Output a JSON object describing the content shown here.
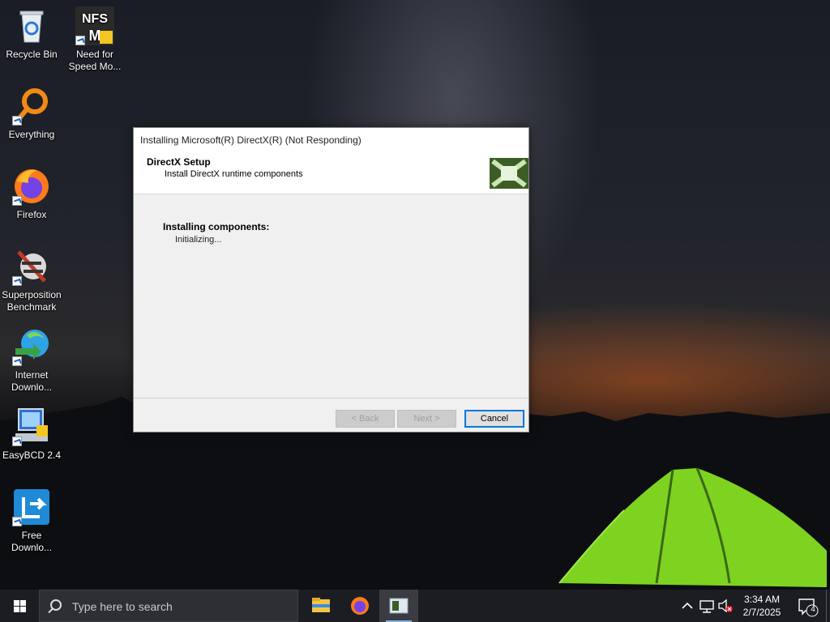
{
  "desktop": {
    "icons": [
      {
        "label": "Recycle Bin",
        "icon": "recycle-bin-icon"
      },
      {
        "label": "Need for Speed Mo...",
        "icon": "nfs-game-icon"
      },
      {
        "label": "Everything",
        "icon": "everything-search-icon"
      },
      {
        "label": "Firefox",
        "icon": "firefox-icon"
      },
      {
        "label": "Superposition Benchmark",
        "icon": "superposition-icon"
      },
      {
        "label": "Internet Downlo...",
        "icon": "idm-icon"
      },
      {
        "label": "EasyBCD 2.4",
        "icon": "easybcd-icon"
      },
      {
        "label": "Free Downlo...",
        "icon": "free-download-manager-icon"
      }
    ]
  },
  "dialog": {
    "title": "Installing Microsoft(R) DirectX(R) (Not Responding)",
    "header_title": "DirectX Setup",
    "header_subtitle": "Install DirectX runtime components",
    "section_label": "Installing components:",
    "status": "Initializing...",
    "buttons": {
      "back": "< Back",
      "next": "Next >",
      "cancel": "Cancel"
    }
  },
  "taskbar": {
    "search_placeholder": "Type here to search",
    "apps": [
      "file-explorer-icon",
      "firefox-icon",
      "directx-setup-icon"
    ],
    "clock_time": "3:34 AM",
    "clock_date": "2/7/2025",
    "notification_count": "4"
  },
  "colors": {
    "accent": "#0078d7",
    "taskbar": "#1b1d22"
  }
}
